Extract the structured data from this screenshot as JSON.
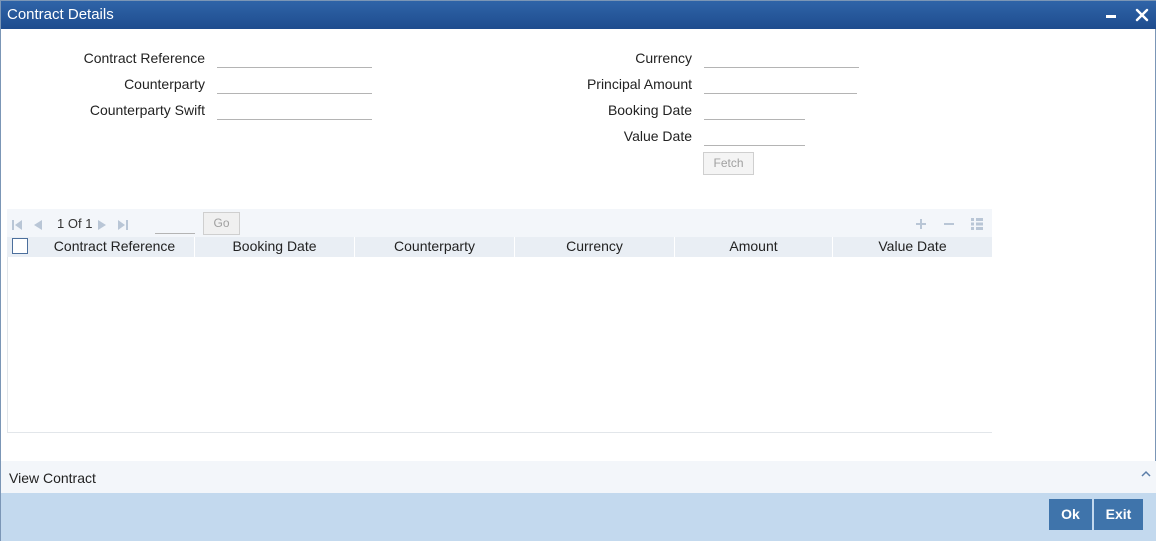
{
  "window": {
    "title": "Contract Details"
  },
  "form": {
    "contract_reference": {
      "label": "Contract Reference",
      "value": ""
    },
    "counterparty": {
      "label": "Counterparty",
      "value": ""
    },
    "counterparty_swift": {
      "label": "Counterparty Swift",
      "value": ""
    },
    "currency": {
      "label": "Currency",
      "value": ""
    },
    "principal_amount": {
      "label": "Principal Amount",
      "value": ""
    },
    "booking_date": {
      "label": "Booking Date",
      "value": ""
    },
    "value_date": {
      "label": "Value Date",
      "value": ""
    },
    "fetch_label": "Fetch"
  },
  "grid": {
    "pager": {
      "current": "1",
      "of_label": "Of",
      "total": "1",
      "go_label": "Go",
      "page_input": ""
    },
    "columns": [
      "Contract Reference",
      "Booking Date",
      "Counterparty",
      "Currency",
      "Amount",
      "Value Date"
    ],
    "rows": []
  },
  "section": {
    "view_contract_label": "View Contract"
  },
  "footer": {
    "ok_label": "Ok",
    "exit_label": "Exit"
  },
  "colors": {
    "titlebar": "#2f64a8",
    "footer": "#c3d9ee",
    "button": "#3f74ab"
  },
  "icons": [
    "minimize-icon",
    "close-icon",
    "first-page-icon",
    "prev-page-icon",
    "next-page-icon",
    "last-page-icon",
    "add-row-icon",
    "delete-row-icon",
    "list-view-icon",
    "chevron-up-icon"
  ]
}
